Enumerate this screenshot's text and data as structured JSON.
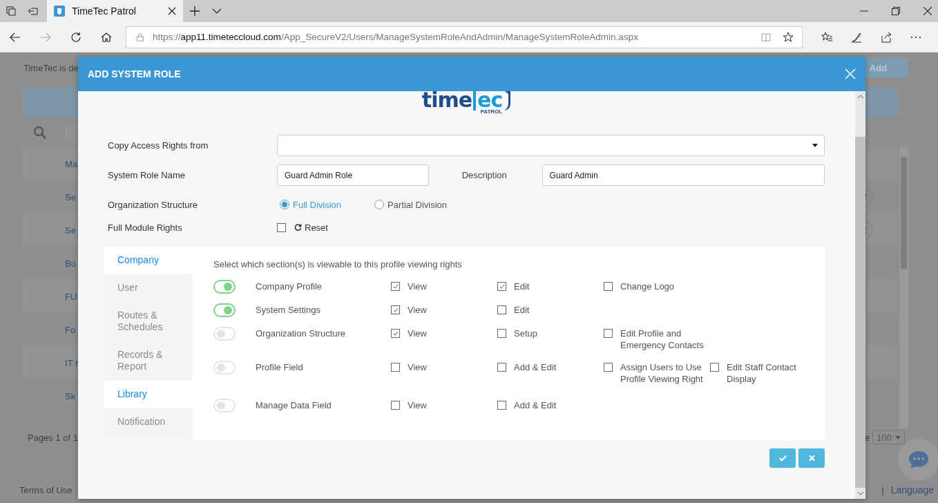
{
  "browser": {
    "tab_title": "TimeTec Patrol",
    "url": {
      "scheme": "https://",
      "host": "app11.timeteccloud.com",
      "path": "/App_SecureV2/Users/ManageSystemRoleAndAdmin/ManageSystemRoleAdmin.aspx"
    }
  },
  "background_page": {
    "intro_text": "TimeTec is de",
    "add_button": "Add",
    "role_rows": [
      {
        "name": "Ma",
        "has_delete": false
      },
      {
        "name": "Se",
        "has_delete": true
      },
      {
        "name": "Se",
        "has_delete": true
      },
      {
        "name": "Bo",
        "has_delete": false
      },
      {
        "name": "FU",
        "has_delete": false
      },
      {
        "name": "Fo",
        "has_delete": false
      },
      {
        "name": "IT r",
        "has_delete": false
      },
      {
        "name": "Sk",
        "has_delete": false
      }
    ],
    "pager_text": "Pages 1 of 1",
    "page_size_label": "e",
    "page_size": "100",
    "terms_link": "Terms of Use",
    "footer_separator": "|",
    "language_link": "Language"
  },
  "dialog": {
    "title": "ADD SYSTEM ROLE",
    "logo": {
      "part_1": "time",
      "part_2": "ec",
      "tagline": "PATROL"
    },
    "copy_rights_label": "Copy Access Rights from",
    "role_name_label": "System Role Name",
    "role_name_value": "Guard Admin Role",
    "description_label": "Description",
    "description_value": "Guard Admin",
    "org_structure": {
      "label": "Organization Structure",
      "options": [
        {
          "label": "Full Division",
          "selected": true
        },
        {
          "label": "Partial Division",
          "selected": false
        }
      ]
    },
    "full_module_rights": {
      "label": "Full Module Rights",
      "checked": false,
      "reset_label": "Reset"
    },
    "tabs": [
      {
        "label": "Company",
        "selected": true
      },
      {
        "label": "User",
        "selected": false
      },
      {
        "label": "Routes & Schedules",
        "selected": false
      },
      {
        "label": "Records & Report",
        "selected": false
      },
      {
        "label": "Library",
        "selected": true
      },
      {
        "label": "Notification",
        "selected": false
      }
    ],
    "instruction": "Select which section(s) is viewable to this profile viewing rights",
    "sections": [
      {
        "name": "Company Profile",
        "on": true,
        "options": [
          {
            "label": "View",
            "checked": true
          },
          {
            "label": "Edit",
            "checked": true
          },
          {
            "label": "Change Logo",
            "checked": false
          }
        ]
      },
      {
        "name": "System Settings",
        "on": true,
        "options": [
          {
            "label": "View",
            "checked": true
          },
          {
            "label": "Edit",
            "checked": false
          }
        ]
      },
      {
        "name": "Organization Structure",
        "on": false,
        "options": [
          {
            "label": "View",
            "checked": true
          },
          {
            "label": "Setup",
            "checked": false
          },
          {
            "label": "Edit Profile and Emergency Contacts",
            "checked": false
          }
        ]
      },
      {
        "name": "Profile Field",
        "on": false,
        "options": [
          {
            "label": "View",
            "checked": false
          },
          {
            "label": "Add & Edit",
            "checked": false
          },
          {
            "label": "Assign Users to Use Profile Viewing Right",
            "checked": false
          },
          {
            "label": "Edit Staff Contact Display",
            "checked": false
          }
        ]
      },
      {
        "name": "Manage Data Field",
        "on": false,
        "options": [
          {
            "label": "View",
            "checked": false
          },
          {
            "label": "Add & Edit",
            "checked": false
          }
        ]
      }
    ]
  }
}
